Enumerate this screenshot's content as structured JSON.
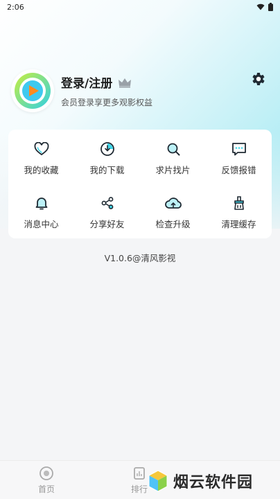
{
  "status_bar": {
    "time": "2:06"
  },
  "profile": {
    "name": "登录/注册",
    "subtitle": "会员登录享更多观影权益"
  },
  "menu": [
    {
      "label": "我的收藏",
      "icon": "heart-icon"
    },
    {
      "label": "我的下载",
      "icon": "download-icon"
    },
    {
      "label": "求片找片",
      "icon": "search-film-icon"
    },
    {
      "label": "反馈报错",
      "icon": "feedback-icon"
    },
    {
      "label": "消息中心",
      "icon": "bell-icon"
    },
    {
      "label": "分享好友",
      "icon": "share-icon"
    },
    {
      "label": "检查升级",
      "icon": "upgrade-icon"
    },
    {
      "label": "清理缓存",
      "icon": "clean-cache-icon"
    }
  ],
  "version": "V1.0.6@清风影视",
  "bottom_nav": [
    {
      "label": "首页",
      "icon": "home-icon"
    },
    {
      "label": "排行",
      "icon": "rank-icon"
    }
  ],
  "watermark": {
    "text": "烟云软件园"
  },
  "colors": {
    "accent": "#3fd6e8",
    "icon_dark": "#1f2a33",
    "orange": "#ff8a1e"
  }
}
